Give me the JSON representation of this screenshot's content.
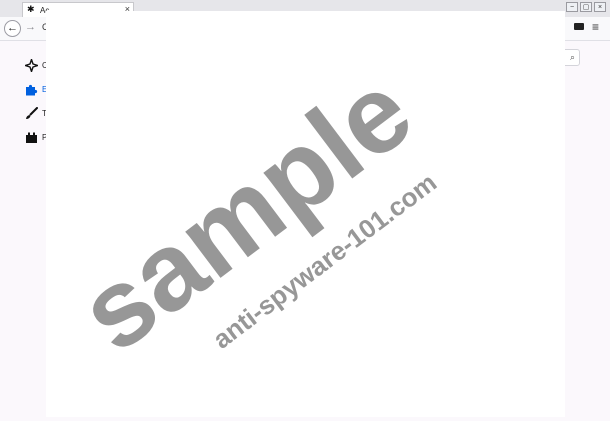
{
  "tab": {
    "title": "Ac",
    "close": "×"
  },
  "window_buttons": [
    "−",
    "▢",
    "×"
  ],
  "nav": {
    "back": "←",
    "forward": "→",
    "reload": "C",
    "menu": "≡"
  },
  "sidebar": {
    "items": [
      {
        "label": "C",
        "icon": "recommendations-icon"
      },
      {
        "label": "E",
        "icon": "extensions-puzzle-icon",
        "active": true
      },
      {
        "label": "T",
        "icon": "themes-brush-icon"
      },
      {
        "label": "P",
        "icon": "plugins-icon"
      }
    ]
  },
  "search": {
    "icon": "⌕"
  },
  "watermark": {
    "main": "sample",
    "sub": "anti-spyware-101.com"
  },
  "colors": {
    "accent": "#0060df",
    "watermark": "#8f8f8f"
  }
}
